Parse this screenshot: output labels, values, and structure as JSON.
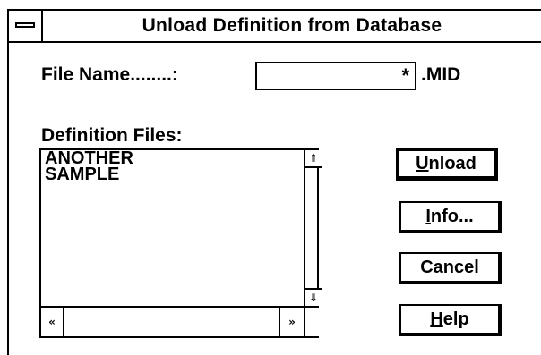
{
  "dialog": {
    "title": "Unload Definition from Database"
  },
  "file_name": {
    "label": "File Name........:",
    "value": "*",
    "extension": ".MID"
  },
  "definition_files": {
    "label": "Definition Files:",
    "items": [
      "ANOTHER",
      "SAMPLE"
    ]
  },
  "buttons": {
    "unload": {
      "mnemonic": "U",
      "rest": "nload"
    },
    "info": {
      "mnemonic": "I",
      "rest": "nfo..."
    },
    "cancel": {
      "label": "Cancel"
    },
    "help": {
      "mnemonic": "H",
      "rest": "elp"
    }
  },
  "icons": {
    "scroll_up": "⇑",
    "scroll_down": "⇓",
    "scroll_left": "«",
    "scroll_right": "»"
  }
}
